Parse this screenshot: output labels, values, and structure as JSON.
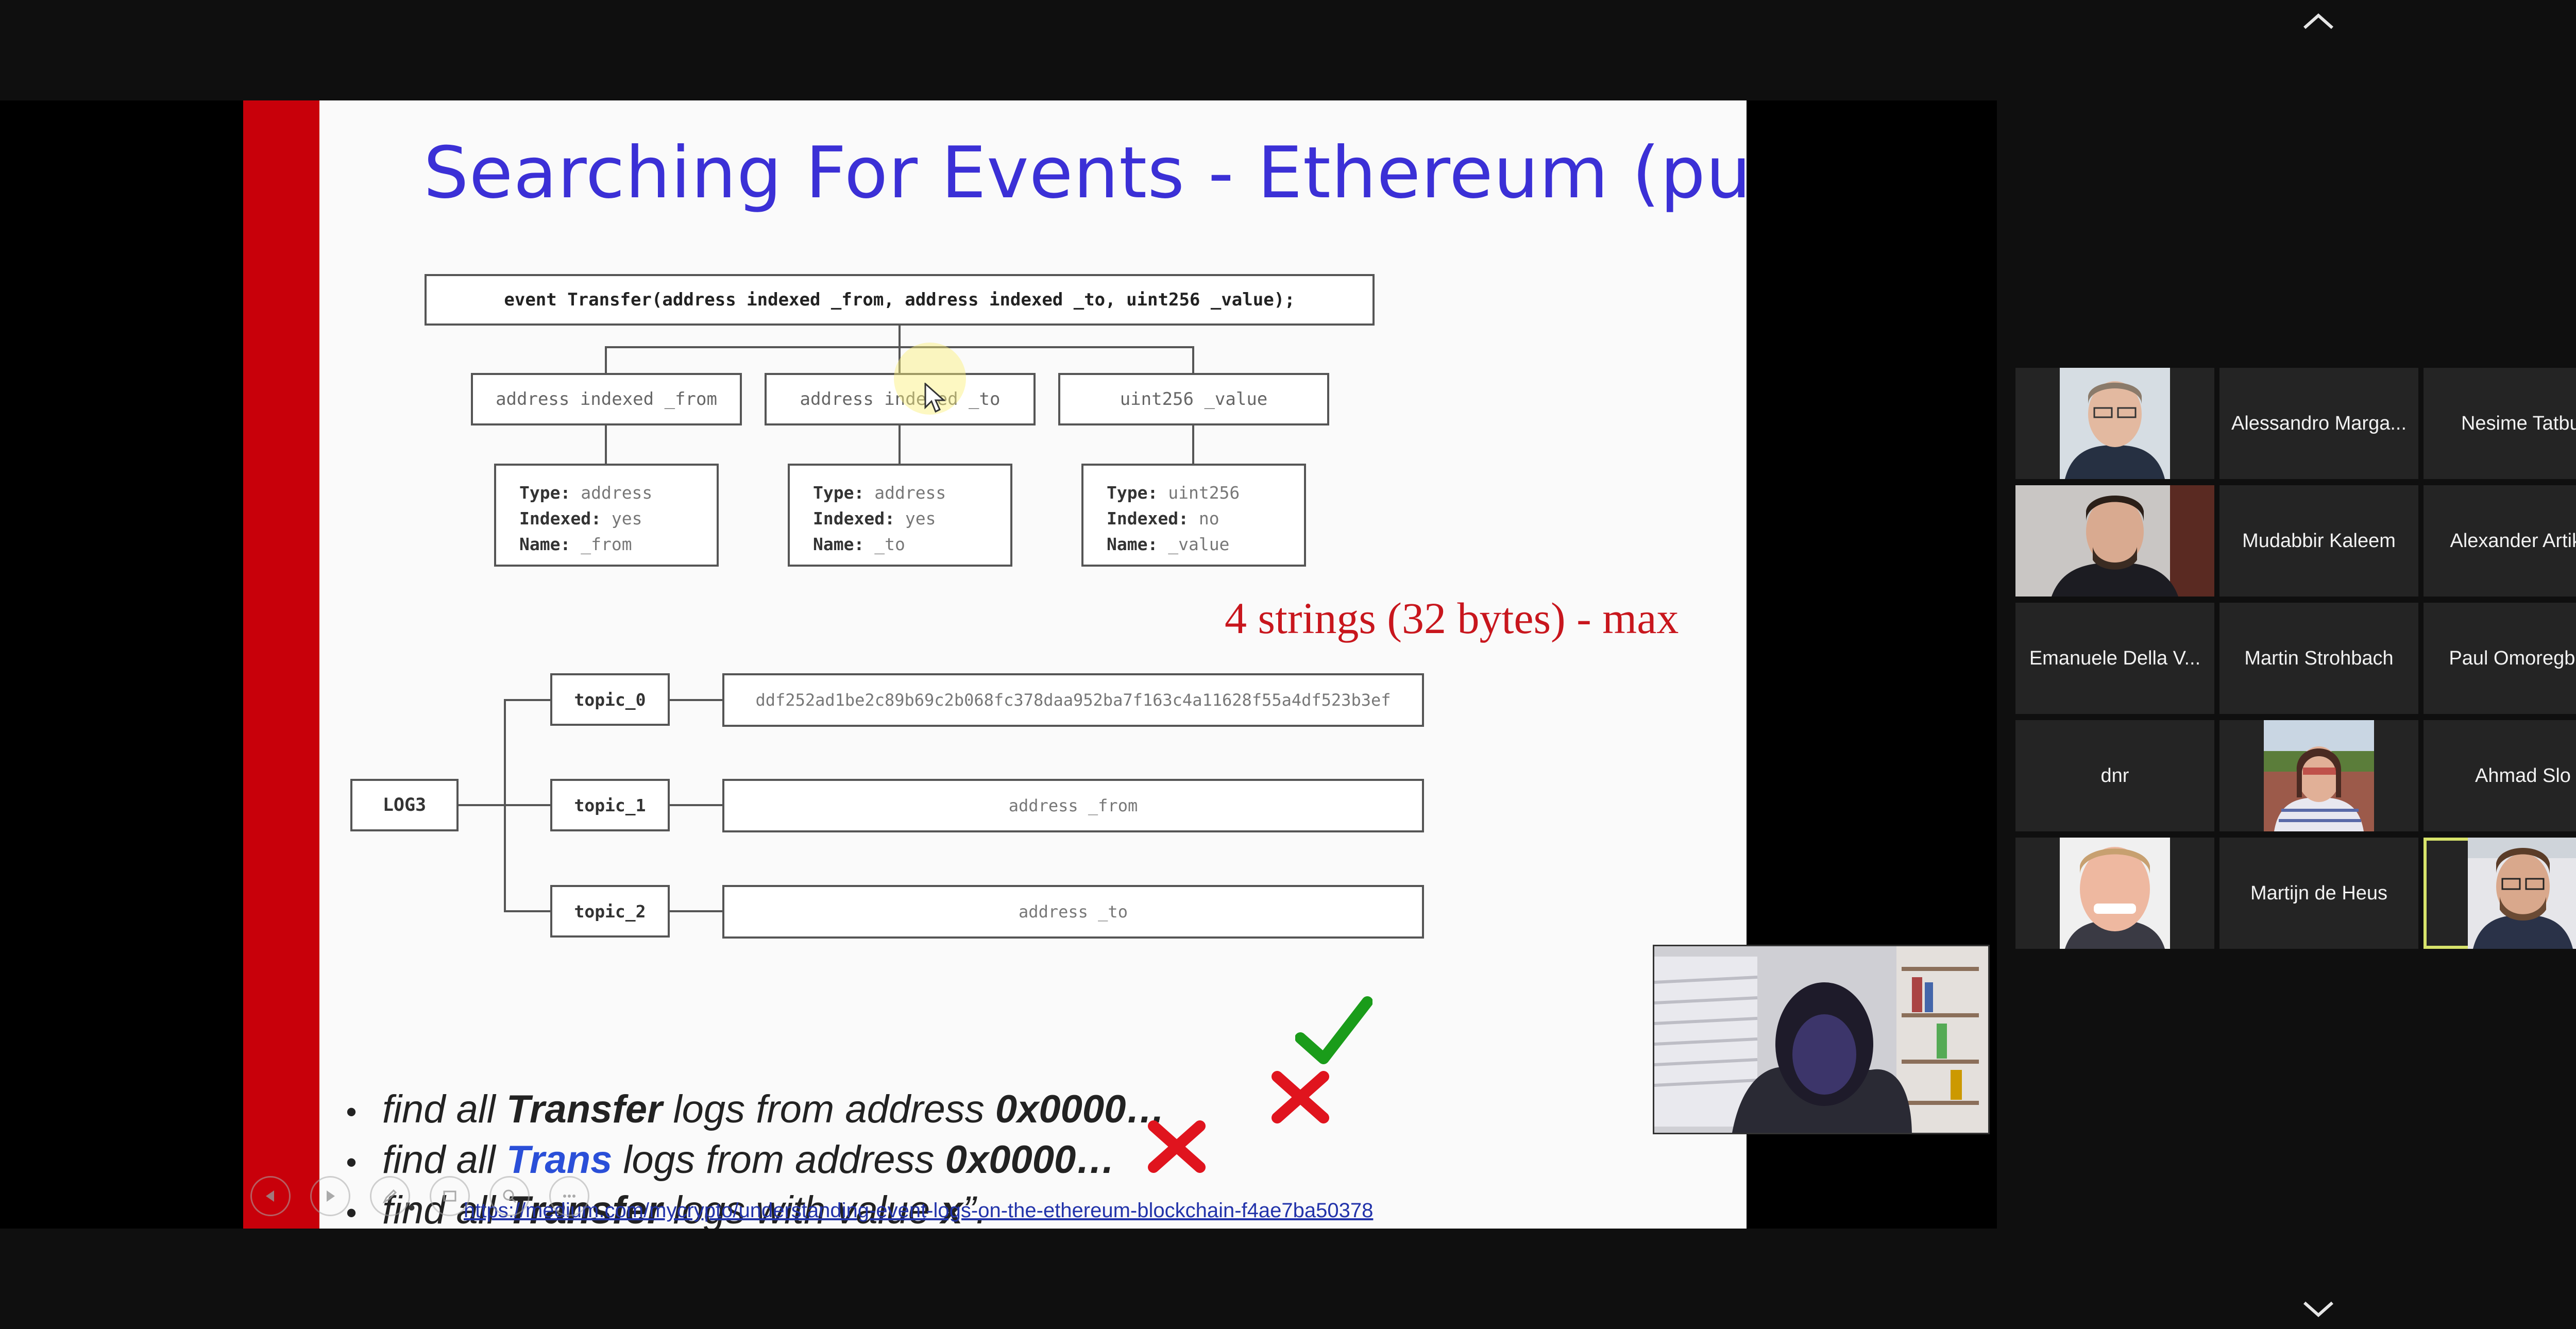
{
  "slide": {
    "title": "Searching For Events - Ethereum (pull)",
    "event_signature": "event Transfer(address indexed _from, address indexed _to, uint256 _value);",
    "params": [
      {
        "label": "address indexed _from",
        "type": "address",
        "indexed": "yes",
        "name": "_from"
      },
      {
        "label": "address indexed _to",
        "type": "address",
        "indexed": "yes",
        "name": "_to"
      },
      {
        "label": "uint256 _value",
        "type": "uint256",
        "indexed": "no",
        "name": "_value"
      }
    ],
    "detail_keys": {
      "type": "Type:",
      "indexed": "Indexed:",
      "name": "Name:"
    },
    "strings_note": "4 strings (32 bytes) - max",
    "log_label": "LOG3",
    "topics": [
      {
        "label": "topic_0",
        "value": "ddf252ad1be2c89b69c2b068fc378daa952ba7f163c4a11628f55a4df523b3ef"
      },
      {
        "label": "topic_1",
        "value": "address _from"
      },
      {
        "label": "topic_2",
        "value": "address _to"
      }
    ],
    "bullets": [
      {
        "pre": "find all ",
        "em": "Transfer",
        "mid": " logs from address ",
        "em2": "0x0000…",
        "post": "",
        "mark": "check"
      },
      {
        "pre": "find all ",
        "em": "Trans",
        "mid": " logs from address ",
        "em2": "0x0000…",
        "post": "",
        "mark": "cross"
      },
      {
        "pre": "find all ",
        "em": "Transfer",
        "mid": " logs with value ",
        "em2": "x",
        "post": "”.",
        "mark": "cross"
      }
    ],
    "bullet_symbol": "•",
    "link": "https://medium.com/mycrypto/understanding-event-logs-on-the-ethereum-blockchain-f4ae7ba50378"
  },
  "participants": [
    {
      "name": "Alessandro Marga...",
      "video": false
    },
    {
      "name": "Nesime Tatbul",
      "video": false
    },
    {
      "name": "Mudabbir Kaleem",
      "video": false
    },
    {
      "name": "Alexander Artikis",
      "video": false
    },
    {
      "name": "Emanuele Della V...",
      "video": false
    },
    {
      "name": "Martin Strohbach",
      "video": false
    },
    {
      "name": "Paul Omoregbee",
      "video": false
    },
    {
      "name": "dnr",
      "video": false
    },
    {
      "name": "Ahmad Slo",
      "video": false
    },
    {
      "name": "Martijn de Heus",
      "video": false
    }
  ],
  "colors": {
    "title": "#3b30d6",
    "accent_red": "#c8000a",
    "active_speaker_border": "#d7e36b",
    "check": "#1a9c1a",
    "cross": "#e0141e"
  },
  "icons": [
    "chevron-up-icon",
    "chevron-down-icon",
    "prev-slide-icon",
    "next-slide-icon",
    "pen-icon",
    "slides-icon",
    "zoom-icon",
    "more-icon"
  ]
}
